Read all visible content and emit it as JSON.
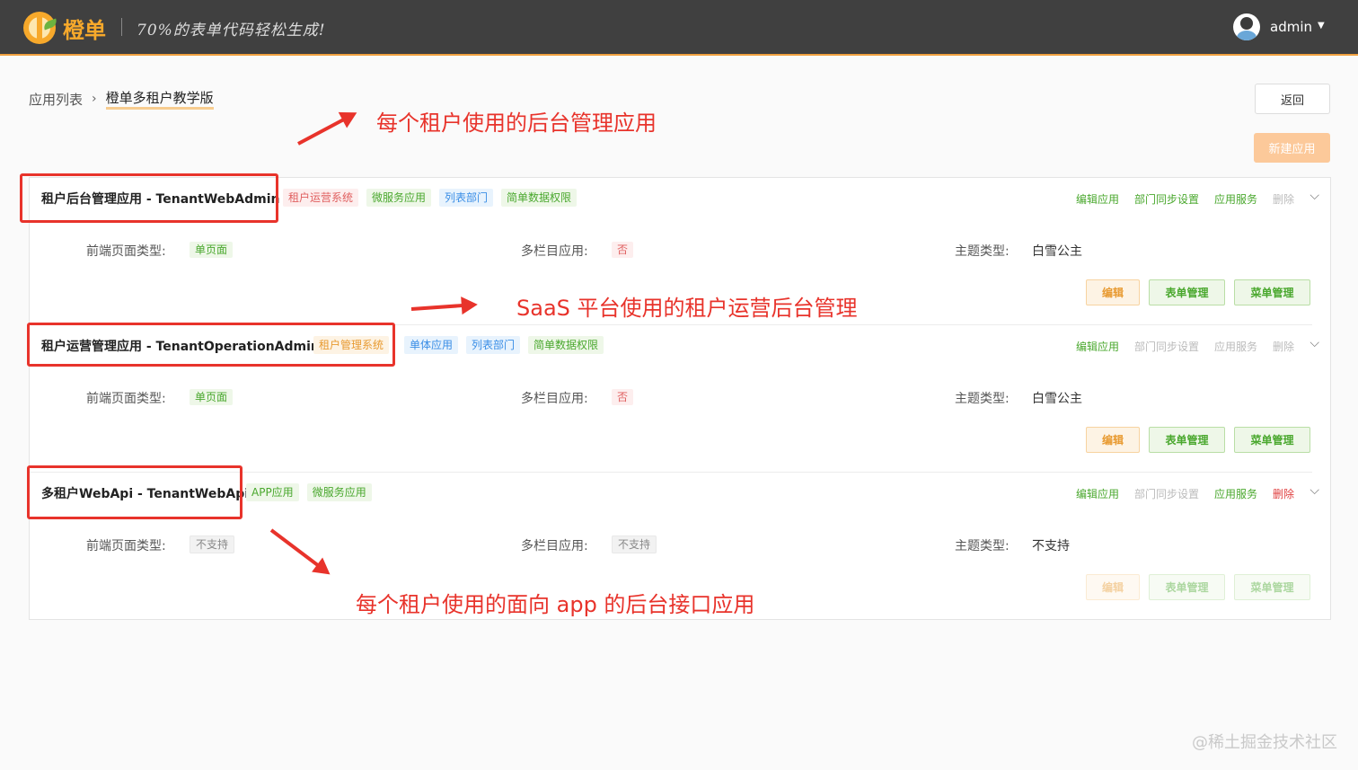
{
  "header": {
    "brand": "橙单",
    "slogan": "70%的表单代码轻松生成!",
    "user": "admin",
    "accent": "#f7a92b"
  },
  "breadcrumb": {
    "root": "应用列表",
    "current": "橙单多租户教学版"
  },
  "toolbar": {
    "back_label": "返回",
    "new_label": "新建应用"
  },
  "apps": [
    {
      "title": "租户后台管理应用 - TenantWebAdmin",
      "tags": [
        "租户运营系统",
        "微服务应用",
        "列表部门",
        "简单数据权限"
      ],
      "actions": [
        "编辑应用",
        "部门同步设置",
        "应用服务",
        "删除"
      ],
      "fields": {
        "page_type_label": "前端页面类型:",
        "page_type": "单页面",
        "multi_label": "多栏目应用:",
        "multi": "否",
        "theme_label": "主题类型:",
        "theme": "白雪公主"
      },
      "buttons": [
        "编辑",
        "表单管理",
        "菜单管理"
      ]
    },
    {
      "title": "租户运营管理应用 - TenantOperationAdmin",
      "tags": [
        "租户管理系统",
        "单体应用",
        "列表部门",
        "简单数据权限"
      ],
      "actions": [
        "编辑应用",
        "部门同步设置",
        "应用服务",
        "删除"
      ],
      "fields": {
        "page_type_label": "前端页面类型:",
        "page_type": "单页面",
        "multi_label": "多栏目应用:",
        "multi": "否",
        "theme_label": "主题类型:",
        "theme": "白雪公主"
      },
      "buttons": [
        "编辑",
        "表单管理",
        "菜单管理"
      ]
    },
    {
      "title": "多租户WebApi - TenantWebApi",
      "tags": [
        "APP应用",
        "微服务应用"
      ],
      "actions": [
        "编辑应用",
        "部门同步设置",
        "应用服务",
        "删除"
      ],
      "fields": {
        "page_type_label": "前端页面类型:",
        "page_type": "不支持",
        "multi_label": "多栏目应用:",
        "multi": "不支持",
        "theme_label": "主题类型:",
        "theme": "不支持"
      },
      "buttons": [
        "编辑",
        "表单管理",
        "菜单管理"
      ]
    }
  ],
  "annotations": {
    "a1": "每个租户使用的后台管理应用",
    "a2": "SaaS 平台使用的租户运营后台管理",
    "a3": "每个租户使用的面向 app 的后台接口应用",
    "color": "#e8332b"
  },
  "watermark": "@稀土掘金技术社区"
}
